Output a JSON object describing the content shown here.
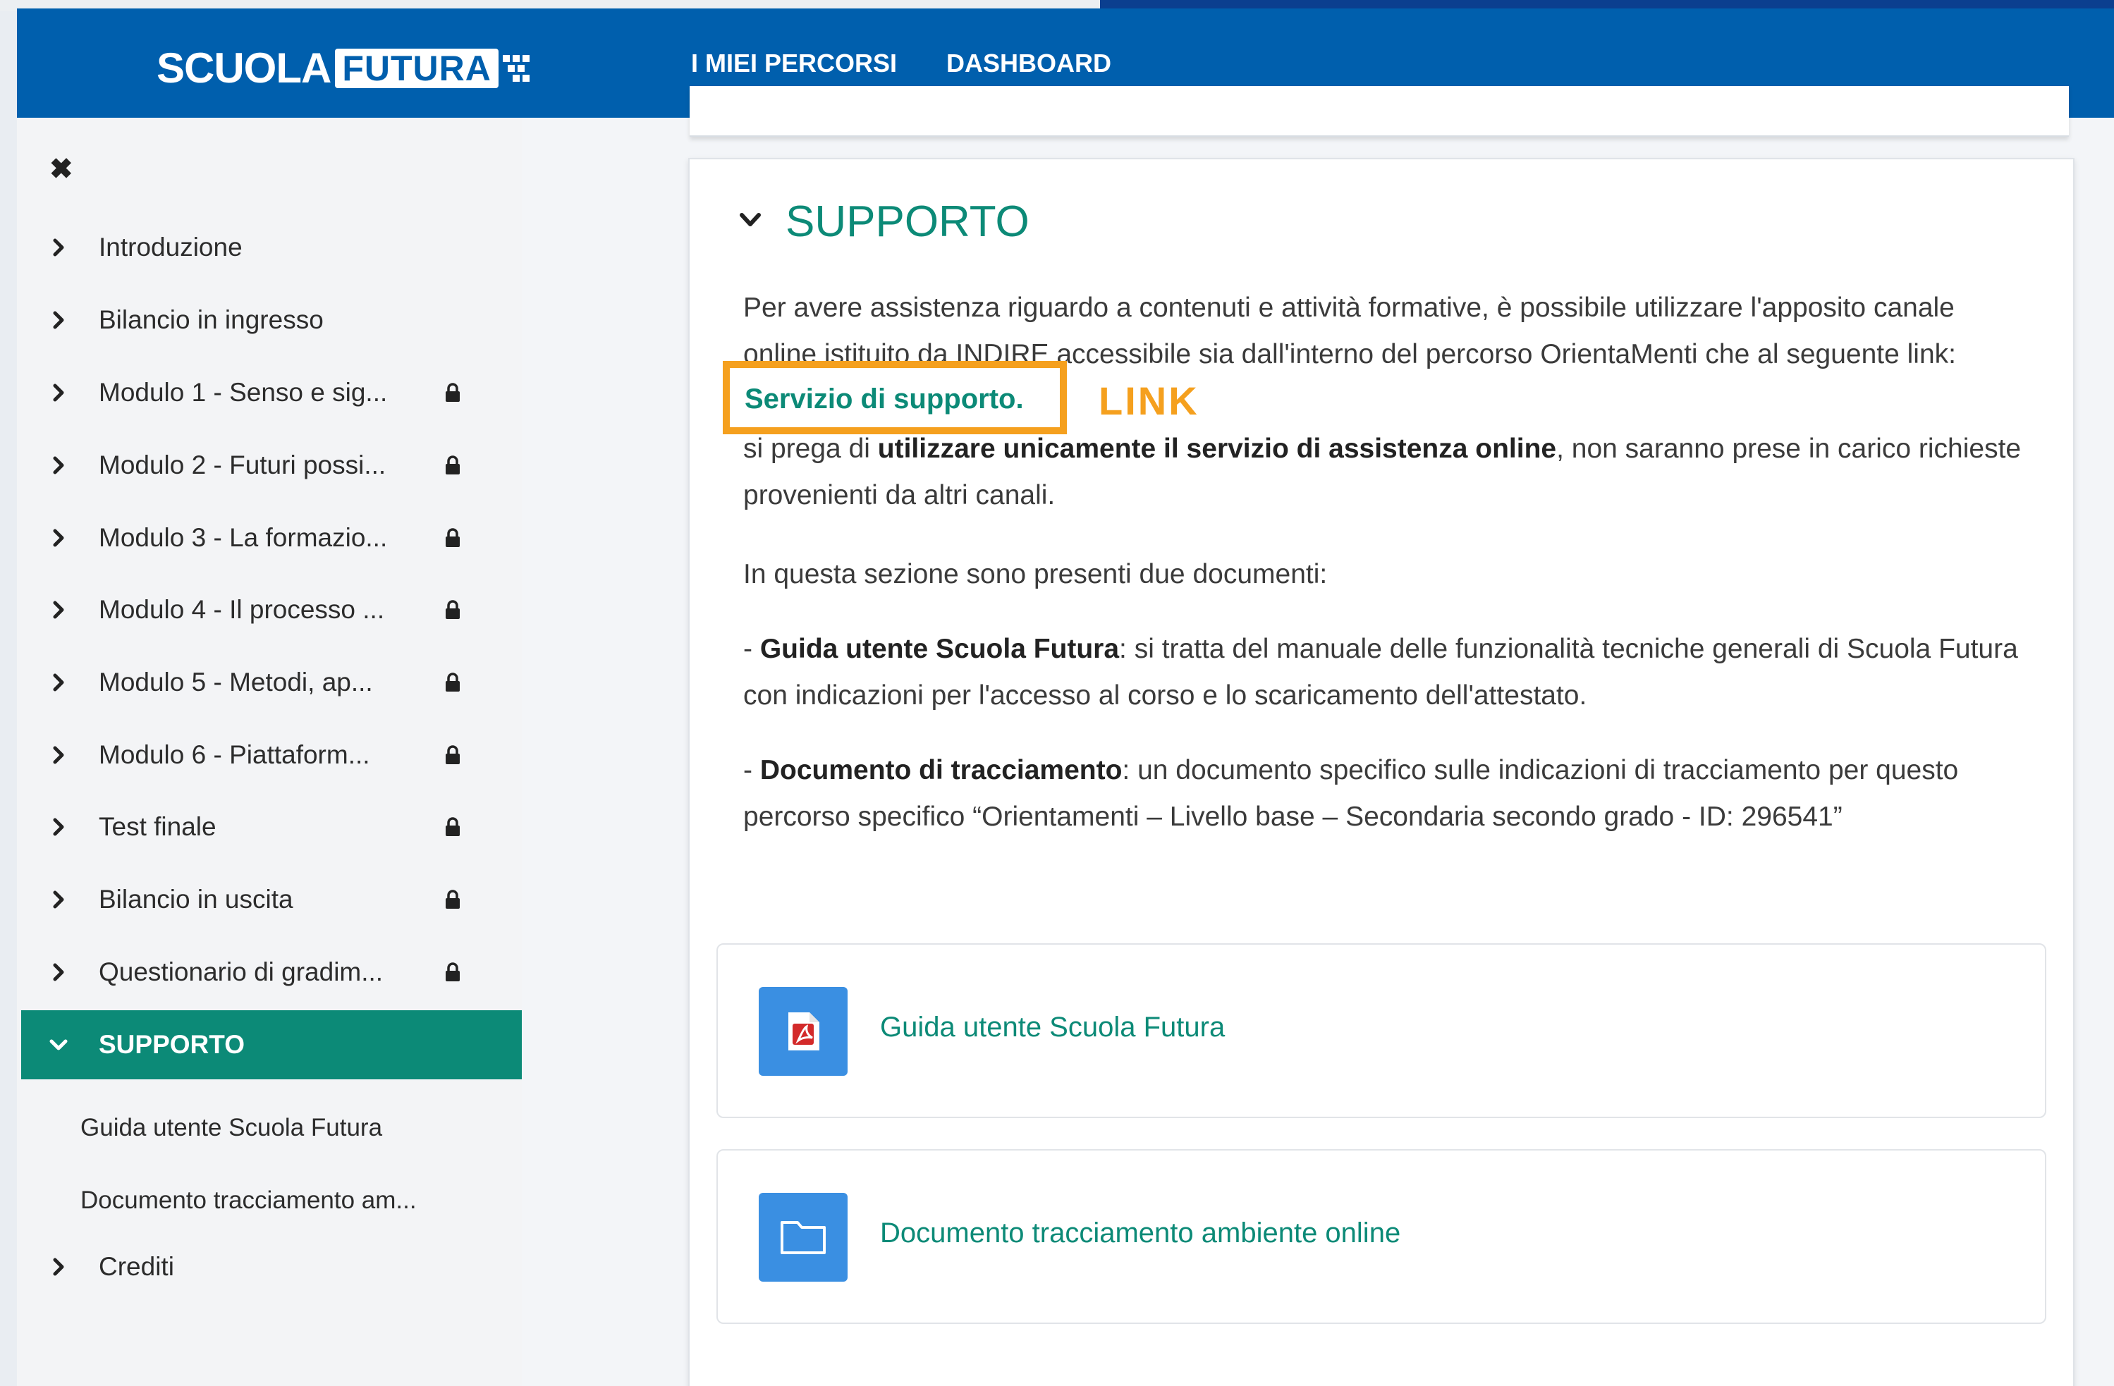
{
  "header": {
    "logo_part1": "SCUOLA",
    "logo_part2": "FUTURA",
    "nav": [
      "I MIEI PERCORSI",
      "DASHBOARD"
    ]
  },
  "sidebar": {
    "close_glyph": "✖",
    "items": [
      {
        "label": "Introduzione",
        "locked": false
      },
      {
        "label": "Bilancio in ingresso",
        "locked": false
      },
      {
        "label": "Modulo 1 - Senso e sig...",
        "locked": true
      },
      {
        "label": "Modulo 2 - Futuri possi...",
        "locked": true
      },
      {
        "label": "Modulo 3 - La formazio...",
        "locked": true
      },
      {
        "label": "Modulo 4 - Il processo ...",
        "locked": true
      },
      {
        "label": "Modulo 5 - Metodi, ap...",
        "locked": true
      },
      {
        "label": "Modulo 6 - Piattaform...",
        "locked": true
      },
      {
        "label": "Test finale",
        "locked": true
      },
      {
        "label": "Bilancio in uscita",
        "locked": true
      },
      {
        "label": "Questionario di gradim...",
        "locked": true
      },
      {
        "label": "SUPPORTO",
        "locked": false,
        "active": true
      },
      {
        "label": "Crediti",
        "locked": false
      }
    ],
    "subitems": [
      "Guida utente Scuola Futura",
      "Documento tracciamento am..."
    ]
  },
  "main": {
    "section_title": "SUPPORTO",
    "intro_line1": "Per avere assistenza riguardo a contenuti e attività formative, è possibile utilizzare l'apposito canale",
    "intro_line2": "online istituito da INDIRE accessibile sia dall'interno del percorso OrientaMenti che al seguente link:",
    "link_text": "Servizio di supporto.",
    "link_annotation": "LINK",
    "warn_visible": "si prega di",
    "warn_bold": "utilizzare unicamente il servizio di assistenza online",
    "warn_rest": ", non saranno prese in carico richieste provenienti da altri canali.",
    "docs_intro": "In questa sezione sono presenti due documenti:",
    "doc1_prefix": "- ",
    "doc1_bold": "Guida utente Scuola Futura",
    "doc1_text": ": si tratta del manuale delle funzionalità tecniche generali di Scuola Futura con indicazioni per l'accesso al corso e lo scaricamento dell'attestato.",
    "doc2_prefix": "- ",
    "doc2_bold": "Documento di tracciamento",
    "doc2_text": ": un documento specifico sulle indicazioni di tracciamento per questo percorso specifico “Orientamenti – Livello base – Secondaria secondo grado - ID: 296541”",
    "resources": [
      {
        "label": "Guida utente Scuola Futura",
        "icon": "pdf-icon"
      },
      {
        "label": "Documento tracciamento ambiente online",
        "icon": "folder-icon"
      }
    ]
  },
  "colors": {
    "header_blue": "#005fad",
    "accent_teal": "#0c8a77",
    "highlight_orange": "#f5a01e",
    "resource_icon_blue": "#3a8fe2"
  }
}
